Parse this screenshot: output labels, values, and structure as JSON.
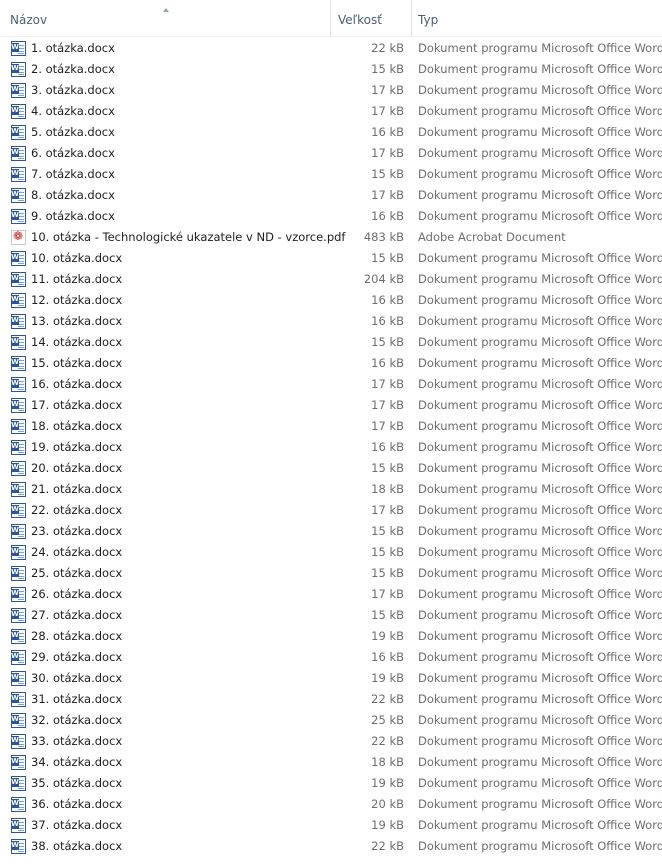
{
  "columns": {
    "name": "Názov",
    "size": "Veľkosť",
    "type": "Typ"
  },
  "files": [
    {
      "name": "1. otázka.docx",
      "size": "22 kB",
      "type": "Dokument programu Microsoft Office Word",
      "icon": "word-doc-icon"
    },
    {
      "name": "2. otázka.docx",
      "size": "15 kB",
      "type": "Dokument programu Microsoft Office Word",
      "icon": "word-doc-icon"
    },
    {
      "name": "3. otázka.docx",
      "size": "17 kB",
      "type": "Dokument programu Microsoft Office Word",
      "icon": "word-doc-icon"
    },
    {
      "name": "4. otázka.docx",
      "size": "17 kB",
      "type": "Dokument programu Microsoft Office Word",
      "icon": "word-doc-icon"
    },
    {
      "name": "5. otázka.docx",
      "size": "16 kB",
      "type": "Dokument programu Microsoft Office Word",
      "icon": "word-doc-icon"
    },
    {
      "name": "6. otázka.docx",
      "size": "17 kB",
      "type": "Dokument programu Microsoft Office Word",
      "icon": "word-doc-icon"
    },
    {
      "name": "7. otázka.docx",
      "size": "15 kB",
      "type": "Dokument programu Microsoft Office Word",
      "icon": "word-doc-icon"
    },
    {
      "name": "8. otázka.docx",
      "size": "17 kB",
      "type": "Dokument programu Microsoft Office Word",
      "icon": "word-doc-icon"
    },
    {
      "name": "9. otázka.docx",
      "size": "16 kB",
      "type": "Dokument programu Microsoft Office Word",
      "icon": "word-doc-icon"
    },
    {
      "name": "10. otázka - Technologické ukazatele v ND - vzorce.pdf",
      "size": "483 kB",
      "type": "Adobe Acrobat Document",
      "icon": "pdf-icon"
    },
    {
      "name": "10. otázka.docx",
      "size": "15 kB",
      "type": "Dokument programu Microsoft Office Word",
      "icon": "word-doc-icon"
    },
    {
      "name": "11. otázka.docx",
      "size": "204 kB",
      "type": "Dokument programu Microsoft Office Word",
      "icon": "word-doc-icon"
    },
    {
      "name": "12. otázka.docx",
      "size": "16 kB",
      "type": "Dokument programu Microsoft Office Word",
      "icon": "word-doc-icon"
    },
    {
      "name": "13. otázka.docx",
      "size": "16 kB",
      "type": "Dokument programu Microsoft Office Word",
      "icon": "word-doc-icon"
    },
    {
      "name": "14. otázka.docx",
      "size": "15 kB",
      "type": "Dokument programu Microsoft Office Word",
      "icon": "word-doc-icon"
    },
    {
      "name": "15. otázka.docx",
      "size": "16 kB",
      "type": "Dokument programu Microsoft Office Word",
      "icon": "word-doc-icon"
    },
    {
      "name": "16. otázka.docx",
      "size": "17 kB",
      "type": "Dokument programu Microsoft Office Word",
      "icon": "word-doc-icon"
    },
    {
      "name": "17. otázka.docx",
      "size": "17 kB",
      "type": "Dokument programu Microsoft Office Word",
      "icon": "word-doc-icon"
    },
    {
      "name": "18. otázka.docx",
      "size": "17 kB",
      "type": "Dokument programu Microsoft Office Word",
      "icon": "word-doc-icon"
    },
    {
      "name": "19. otázka.docx",
      "size": "16 kB",
      "type": "Dokument programu Microsoft Office Word",
      "icon": "word-doc-icon"
    },
    {
      "name": "20. otázka.docx",
      "size": "15 kB",
      "type": "Dokument programu Microsoft Office Word",
      "icon": "word-doc-icon"
    },
    {
      "name": "21. otázka.docx",
      "size": "18 kB",
      "type": "Dokument programu Microsoft Office Word",
      "icon": "word-doc-icon"
    },
    {
      "name": "22. otázka.docx",
      "size": "17 kB",
      "type": "Dokument programu Microsoft Office Word",
      "icon": "word-doc-icon"
    },
    {
      "name": "23. otázka.docx",
      "size": "15 kB",
      "type": "Dokument programu Microsoft Office Word",
      "icon": "word-doc-icon"
    },
    {
      "name": "24. otázka.docx",
      "size": "15 kB",
      "type": "Dokument programu Microsoft Office Word",
      "icon": "word-doc-icon"
    },
    {
      "name": "25. otázka.docx",
      "size": "15 kB",
      "type": "Dokument programu Microsoft Office Word",
      "icon": "word-doc-icon"
    },
    {
      "name": "26. otázka.docx",
      "size": "17 kB",
      "type": "Dokument programu Microsoft Office Word",
      "icon": "word-doc-icon"
    },
    {
      "name": "27. otázka.docx",
      "size": "15 kB",
      "type": "Dokument programu Microsoft Office Word",
      "icon": "word-doc-icon"
    },
    {
      "name": "28. otázka.docx",
      "size": "19 kB",
      "type": "Dokument programu Microsoft Office Word",
      "icon": "word-doc-icon"
    },
    {
      "name": "29. otázka.docx",
      "size": "16 kB",
      "type": "Dokument programu Microsoft Office Word",
      "icon": "word-doc-icon"
    },
    {
      "name": "30. otázka.docx",
      "size": "19 kB",
      "type": "Dokument programu Microsoft Office Word",
      "icon": "word-doc-icon"
    },
    {
      "name": "31. otázka.docx",
      "size": "22 kB",
      "type": "Dokument programu Microsoft Office Word",
      "icon": "word-doc-icon"
    },
    {
      "name": "32. otázka.docx",
      "size": "25 kB",
      "type": "Dokument programu Microsoft Office Word",
      "icon": "word-doc-icon"
    },
    {
      "name": "33. otázka.docx",
      "size": "22 kB",
      "type": "Dokument programu Microsoft Office Word",
      "icon": "word-doc-icon"
    },
    {
      "name": "34. otázka.docx",
      "size": "18 kB",
      "type": "Dokument programu Microsoft Office Word",
      "icon": "word-doc-icon"
    },
    {
      "name": "35. otázka.docx",
      "size": "19 kB",
      "type": "Dokument programu Microsoft Office Word",
      "icon": "word-doc-icon"
    },
    {
      "name": "36. otázka.docx",
      "size": "20 kB",
      "type": "Dokument programu Microsoft Office Word",
      "icon": "word-doc-icon"
    },
    {
      "name": "37. otázka.docx",
      "size": "19 kB",
      "type": "Dokument programu Microsoft Office Word",
      "icon": "word-doc-icon"
    },
    {
      "name": "38. otázka.docx",
      "size": "22 kB",
      "type": "Dokument programu Microsoft Office Word",
      "icon": "word-doc-icon"
    }
  ]
}
